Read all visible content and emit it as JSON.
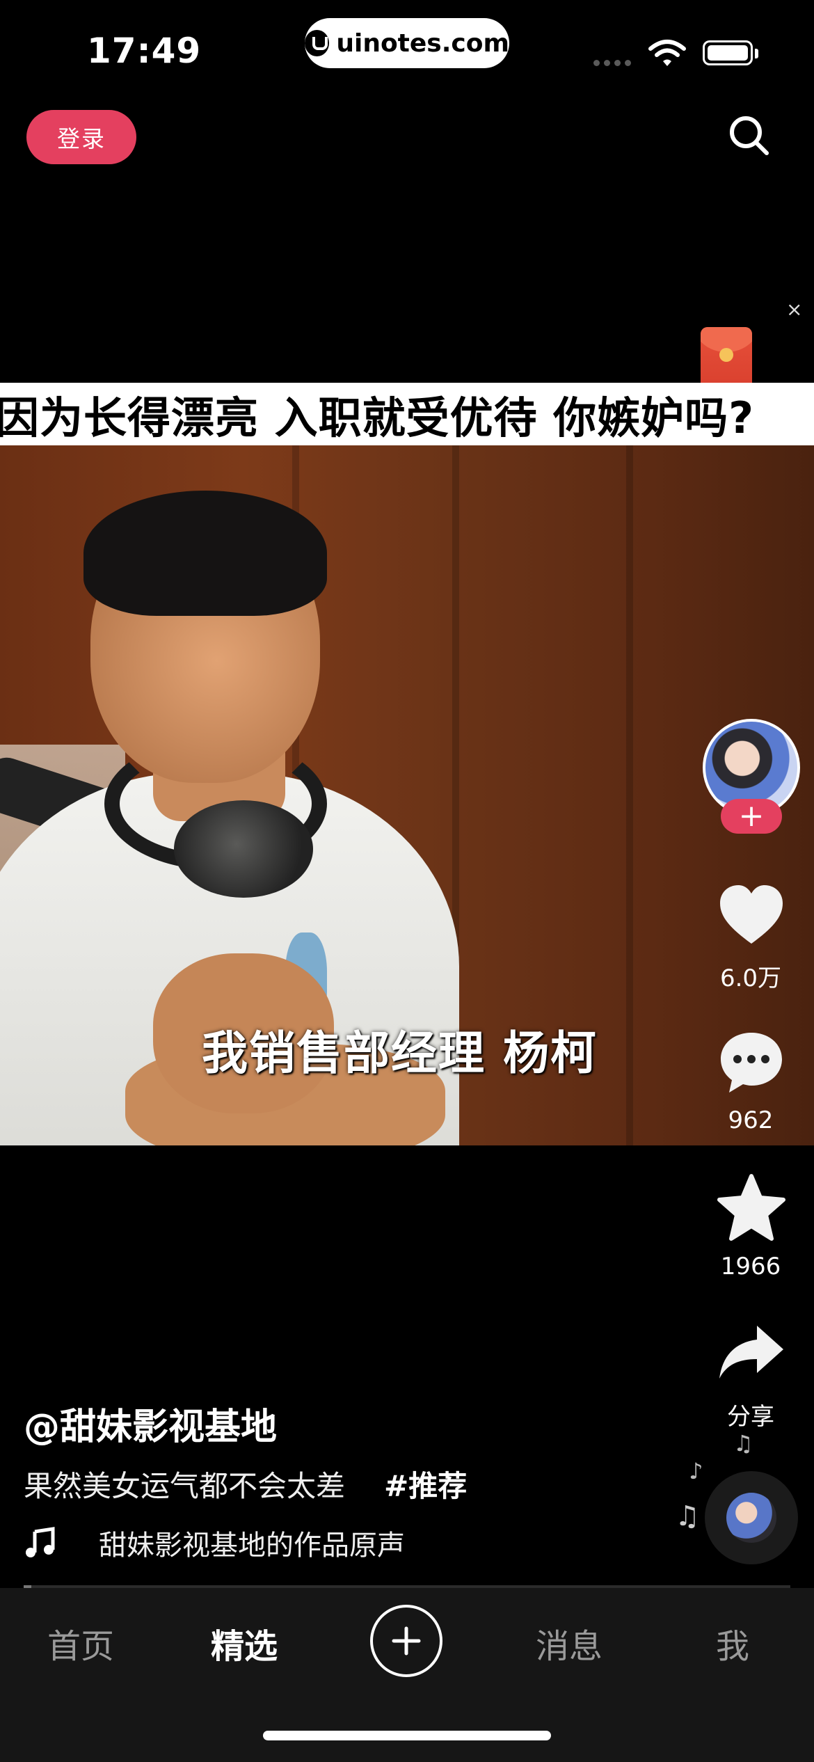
{
  "status_bar": {
    "time": "17:49",
    "url": "uinotes.com",
    "icons": [
      "signal-icon",
      "wifi-icon",
      "battery-icon"
    ]
  },
  "header": {
    "login_label": "登录",
    "search_icon": "search-icon"
  },
  "promo": {
    "close_label": "×",
    "icon": "red-packet-icon"
  },
  "video": {
    "title_overlay": "因为长得漂亮 入职就受优待 你嫉妒吗?",
    "subtitle": "我销售部经理 杨柯"
  },
  "actions": {
    "follow_label": "+",
    "likes": "6.0万",
    "comments": "962",
    "favorites": "1966",
    "share_label": "分享"
  },
  "caption": {
    "author": "@甜妹影视基地",
    "description": "果然美女运气都不会太差",
    "hashtag": "#推荐",
    "music": "甜妹影视基地的作品原声"
  },
  "progress": {
    "value": 0.01
  },
  "tabbar": {
    "items": [
      {
        "label": "首页",
        "active": false
      },
      {
        "label": "精选",
        "active": true
      },
      {
        "label": "+",
        "active": false
      },
      {
        "label": "消息",
        "active": false
      },
      {
        "label": "我",
        "active": false
      }
    ]
  },
  "colors": {
    "accent": "#e4405f",
    "background": "#000000",
    "tabbar": "#161616"
  }
}
